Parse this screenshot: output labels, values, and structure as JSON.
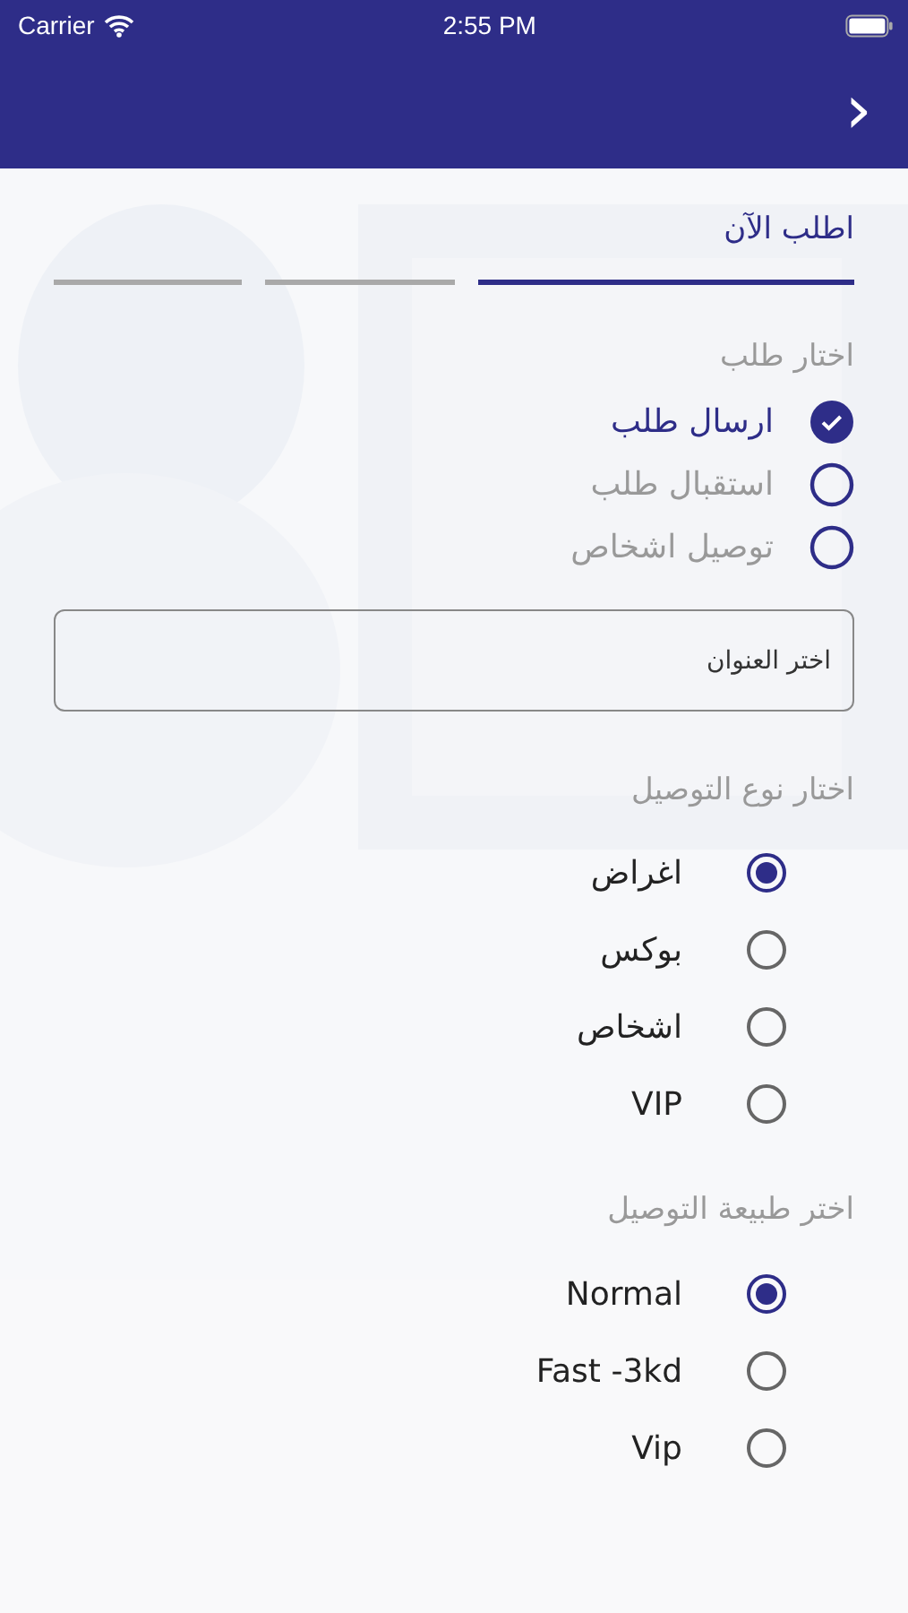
{
  "status_bar": {
    "carrier": "Carrier",
    "time": "2:55 PM"
  },
  "header": {
    "back_glyph": "›"
  },
  "title": "اطلب الآن",
  "steps": [
    {
      "selected": true
    },
    {
      "selected": false
    },
    {
      "selected": false
    }
  ],
  "request_type": {
    "label": "اختار طلب",
    "options": [
      {
        "label": "ارسال طلب",
        "selected": true
      },
      {
        "label": "استقبال طلب",
        "selected": false
      },
      {
        "label": "توصيل اشخاص",
        "selected": false
      }
    ]
  },
  "address_field": {
    "placeholder": "اختر العنوان"
  },
  "delivery_type": {
    "label": "اختار نوع التوصيل",
    "options": [
      {
        "label": "اغراض",
        "selected": true
      },
      {
        "label": "بوكس",
        "selected": false
      },
      {
        "label": "اشخاص",
        "selected": false
      },
      {
        "label": "VIP",
        "selected": false
      }
    ]
  },
  "delivery_speed": {
    "label": "اختر طبيعة التوصيل",
    "options": [
      {
        "label": "Normal",
        "selected": true
      },
      {
        "label": "Fast -3kd",
        "selected": false
      },
      {
        "label": "Vip",
        "selected": false
      }
    ]
  }
}
